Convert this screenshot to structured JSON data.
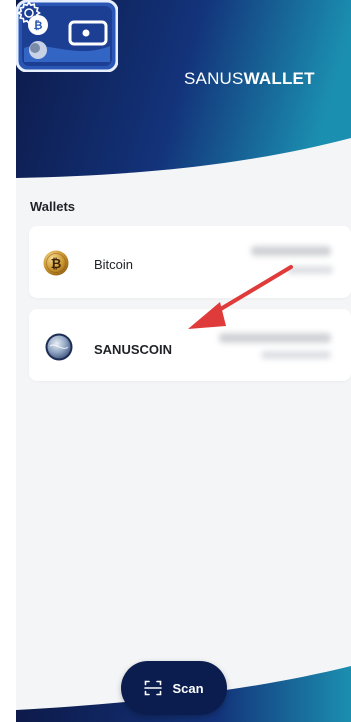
{
  "app": {
    "title_regular": "SANUS",
    "title_bold": "WALLET"
  },
  "section": {
    "wallets_title": "Wallets"
  },
  "wallets": [
    {
      "name": "Bitcoin",
      "icon": "bitcoin-coin-icon"
    },
    {
      "name": "SANUSCOIN",
      "icon": "sanuscoin-coin-icon"
    }
  ],
  "scan": {
    "label": "Scan",
    "icon": "scan-frame-icon"
  },
  "header": {
    "icons": [
      "wallet-logo-icon",
      "settings-gear-icon"
    ]
  },
  "colors": {
    "header_dark": "#0d1a4a",
    "header_teal": "#1b8fb0",
    "arrow_red": "#e03b3b",
    "scan_bg": "#0b1d4f"
  }
}
